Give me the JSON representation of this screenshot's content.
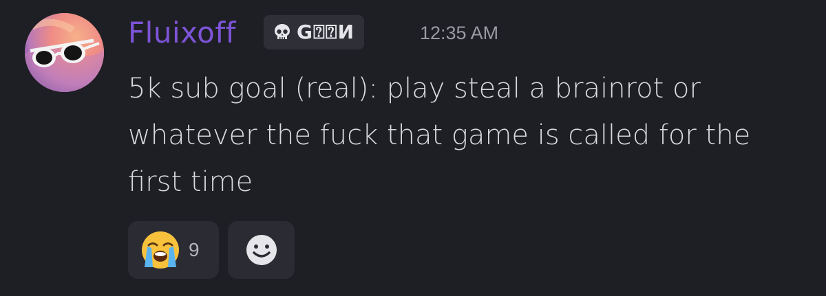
{
  "message": {
    "author": "Fluixoff",
    "tag": "G⍰⍰И",
    "timestamp": "12:35 AM",
    "content": "5k sub goal (real): play steal a brainrot or whatever the fuck that game is called for the first time",
    "author_color": "#7d54d8",
    "tag_icon": "skull-icon"
  },
  "reactions": [
    {
      "emoji": "loudly-crying-face",
      "count": "9"
    }
  ],
  "add_reaction_icon": "smiley-add-reaction-icon"
}
